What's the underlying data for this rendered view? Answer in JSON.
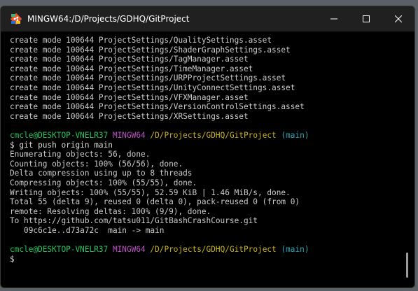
{
  "window": {
    "title": "MINGW64:/D/Projects/GDHQ/GitProject",
    "icon": "git-bash-icon",
    "controls": [
      "minimize-icon",
      "maximize-icon",
      "close-icon"
    ]
  },
  "terminal": {
    "create_lines": [
      "create mode 100644 ProjectSettings/QualitySettings.asset",
      "create mode 100644 ProjectSettings/ShaderGraphSettings.asset",
      "create mode 100644 ProjectSettings/TagManager.asset",
      "create mode 100644 ProjectSettings/TimeManager.asset",
      "create mode 100644 ProjectSettings/URPProjectSettings.asset",
      "create mode 100644 ProjectSettings/UnityConnectSettings.asset",
      "create mode 100644 ProjectSettings/VFXManager.asset",
      "create mode 100644 ProjectSettings/VersionControlSettings.asset",
      "create mode 100644 ProjectSettings/XRSettings.asset"
    ],
    "prompt1": {
      "user_host": "cmcle@DESKTOP-VNELR37",
      "shell": "MINGW64",
      "path": "/D/Projects/GDHQ/GitProject",
      "branch": "(main)"
    },
    "command": "$ git push origin main",
    "output_lines": [
      "Enumerating objects: 56, done.",
      "Counting objects: 100% (56/56), done.",
      "Delta compression using up to 8 threads",
      "Compressing objects: 100% (55/55), done.",
      "Writing objects: 100% (55/55), 52.59 KiB | 1.46 MiB/s, done.",
      "Total 55 (delta 9), reused 0 (delta 0), pack-reused 0 (from 0)",
      "remote: Resolving deltas: 100% (9/9), done.",
      "To https://github.com/tatsu011/GitBashCrashCourse.git",
      "   09c6c1e..d73a72c  main -> main"
    ],
    "prompt2": {
      "user_host": "cmcle@DESKTOP-VNELR37",
      "shell": "MINGW64",
      "path": "/D/Projects/GDHQ/GitProject",
      "branch": "(main)"
    },
    "cursor_prompt": "$"
  },
  "colors": {
    "background": "#000000",
    "titlebar": "#202020",
    "text": "#cccccc",
    "user_host": "#23c55e",
    "shell": "#c050c8",
    "path": "#c7b21b",
    "branch": "#2aa8b5"
  }
}
